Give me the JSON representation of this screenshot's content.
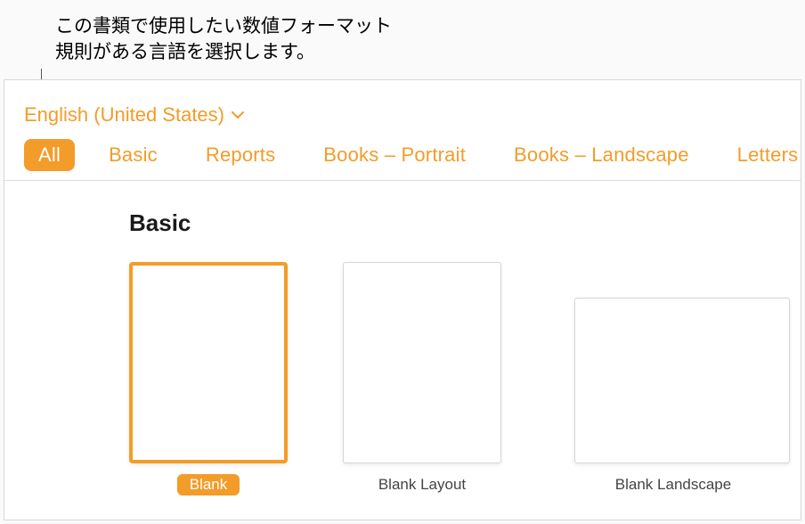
{
  "annotation": {
    "line1": "この書類で使用したい数値フォーマット",
    "line2": "規則がある言語を選択します。"
  },
  "language_dropdown": {
    "label": "English (United States)"
  },
  "tabs": [
    {
      "label": "All",
      "selected": true
    },
    {
      "label": "Basic",
      "selected": false
    },
    {
      "label": "Reports",
      "selected": false
    },
    {
      "label": "Books – Portrait",
      "selected": false
    },
    {
      "label": "Books – Landscape",
      "selected": false
    },
    {
      "label": "Letters",
      "selected": false
    }
  ],
  "section": {
    "title": "Basic"
  },
  "templates": [
    {
      "label": "Blank",
      "selected": true,
      "shape": "portrait"
    },
    {
      "label": "Blank Layout",
      "selected": false,
      "shape": "portrait"
    },
    {
      "label": "Blank Landscape",
      "selected": false,
      "shape": "landscape"
    }
  ],
  "colors": {
    "accent": "#f39c29"
  }
}
